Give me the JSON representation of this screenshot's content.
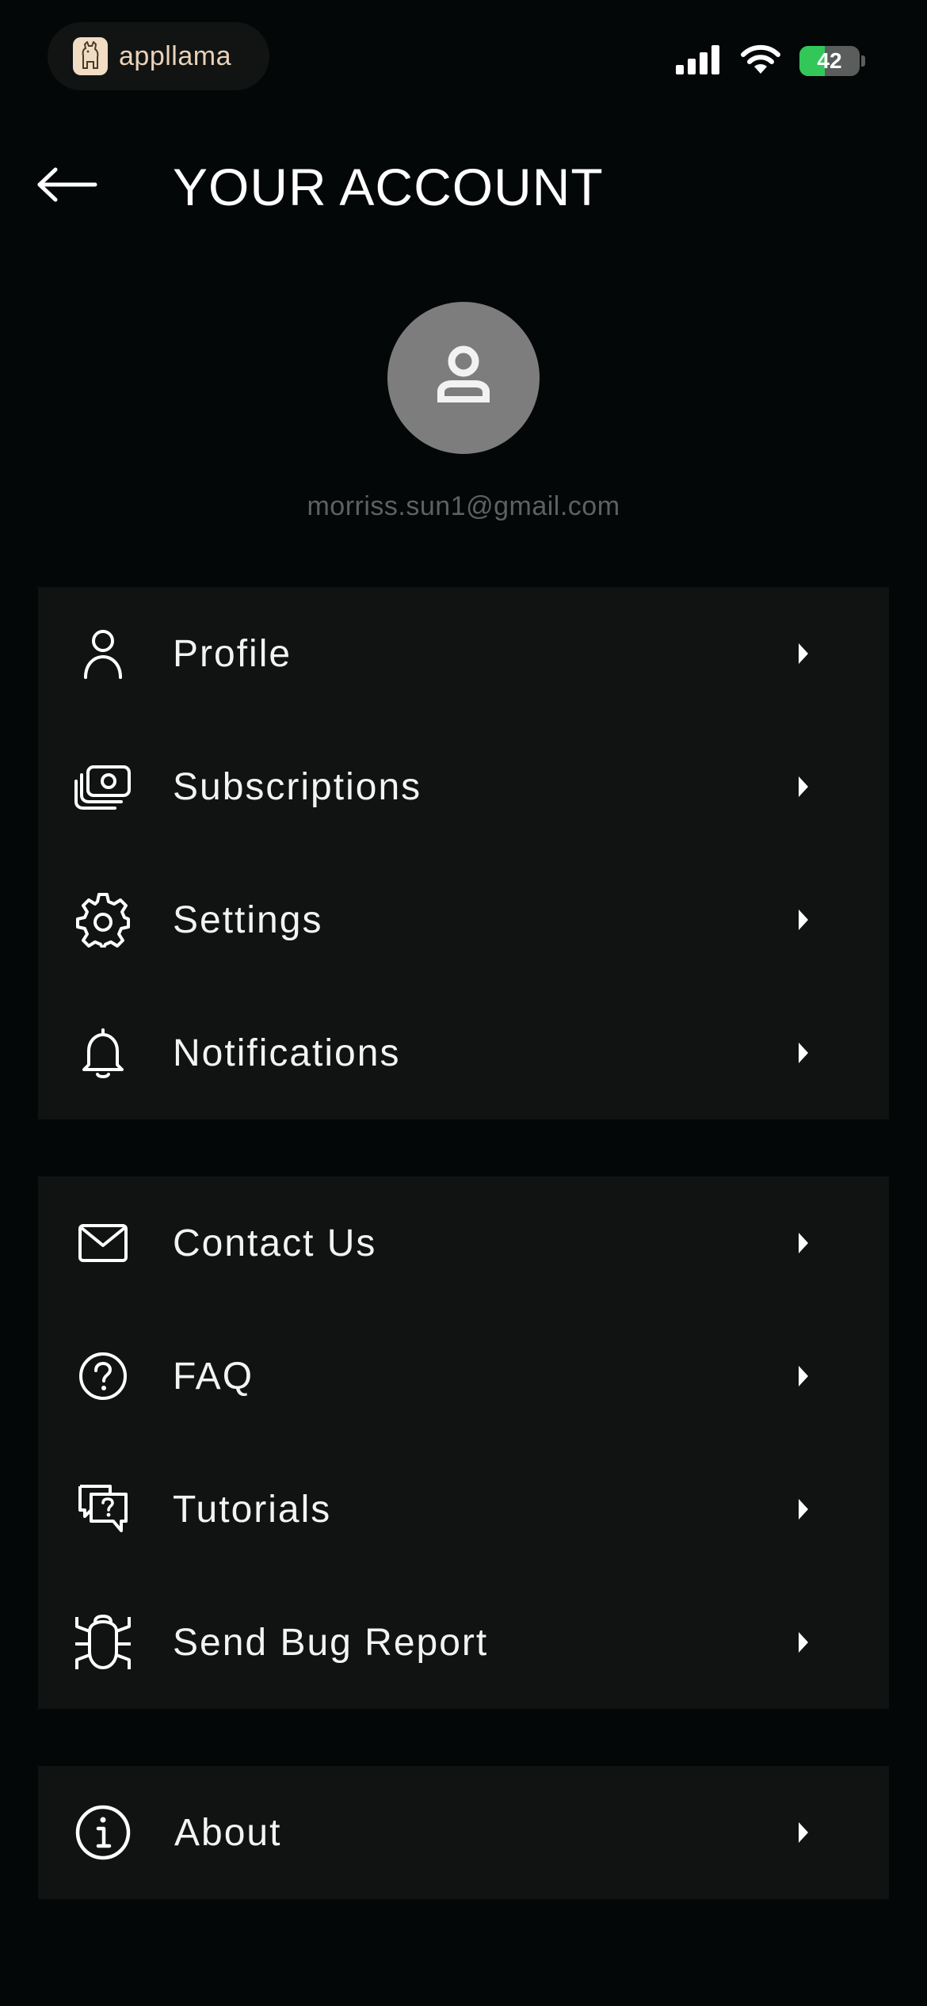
{
  "status_bar": {
    "app_name": "appllama",
    "battery_level": "42",
    "battery_percent": 42,
    "battery_color": "#33c759",
    "icons": [
      "cellular-signal-icon",
      "wifi-icon",
      "battery-charging-icon"
    ]
  },
  "header": {
    "title": "YOUR ACCOUNT",
    "back_icon": "arrow-left-icon"
  },
  "account": {
    "avatar_icon": "person-icon",
    "email": "morriss.sun1@gmail.com"
  },
  "menu_groups": [
    {
      "items": [
        {
          "label": "Profile",
          "icon": "person-outline-icon"
        },
        {
          "label": "Subscriptions",
          "icon": "money-stack-icon"
        },
        {
          "label": "Settings",
          "icon": "gear-icon"
        },
        {
          "label": "Notifications",
          "icon": "bell-icon"
        }
      ]
    },
    {
      "items": [
        {
          "label": "Contact Us",
          "icon": "envelope-icon"
        },
        {
          "label": "FAQ",
          "icon": "question-circle-icon"
        },
        {
          "label": "Tutorials",
          "icon": "chat-question-icon"
        },
        {
          "label": "Send Bug Report",
          "icon": "bug-icon"
        }
      ]
    },
    {
      "items": [
        {
          "label": "About",
          "icon": "info-circle-icon"
        }
      ]
    }
  ],
  "colors": {
    "background": "#040707",
    "card": "#111312",
    "email_text": "#5e615f",
    "avatar_bg": "#7d7d7d"
  }
}
